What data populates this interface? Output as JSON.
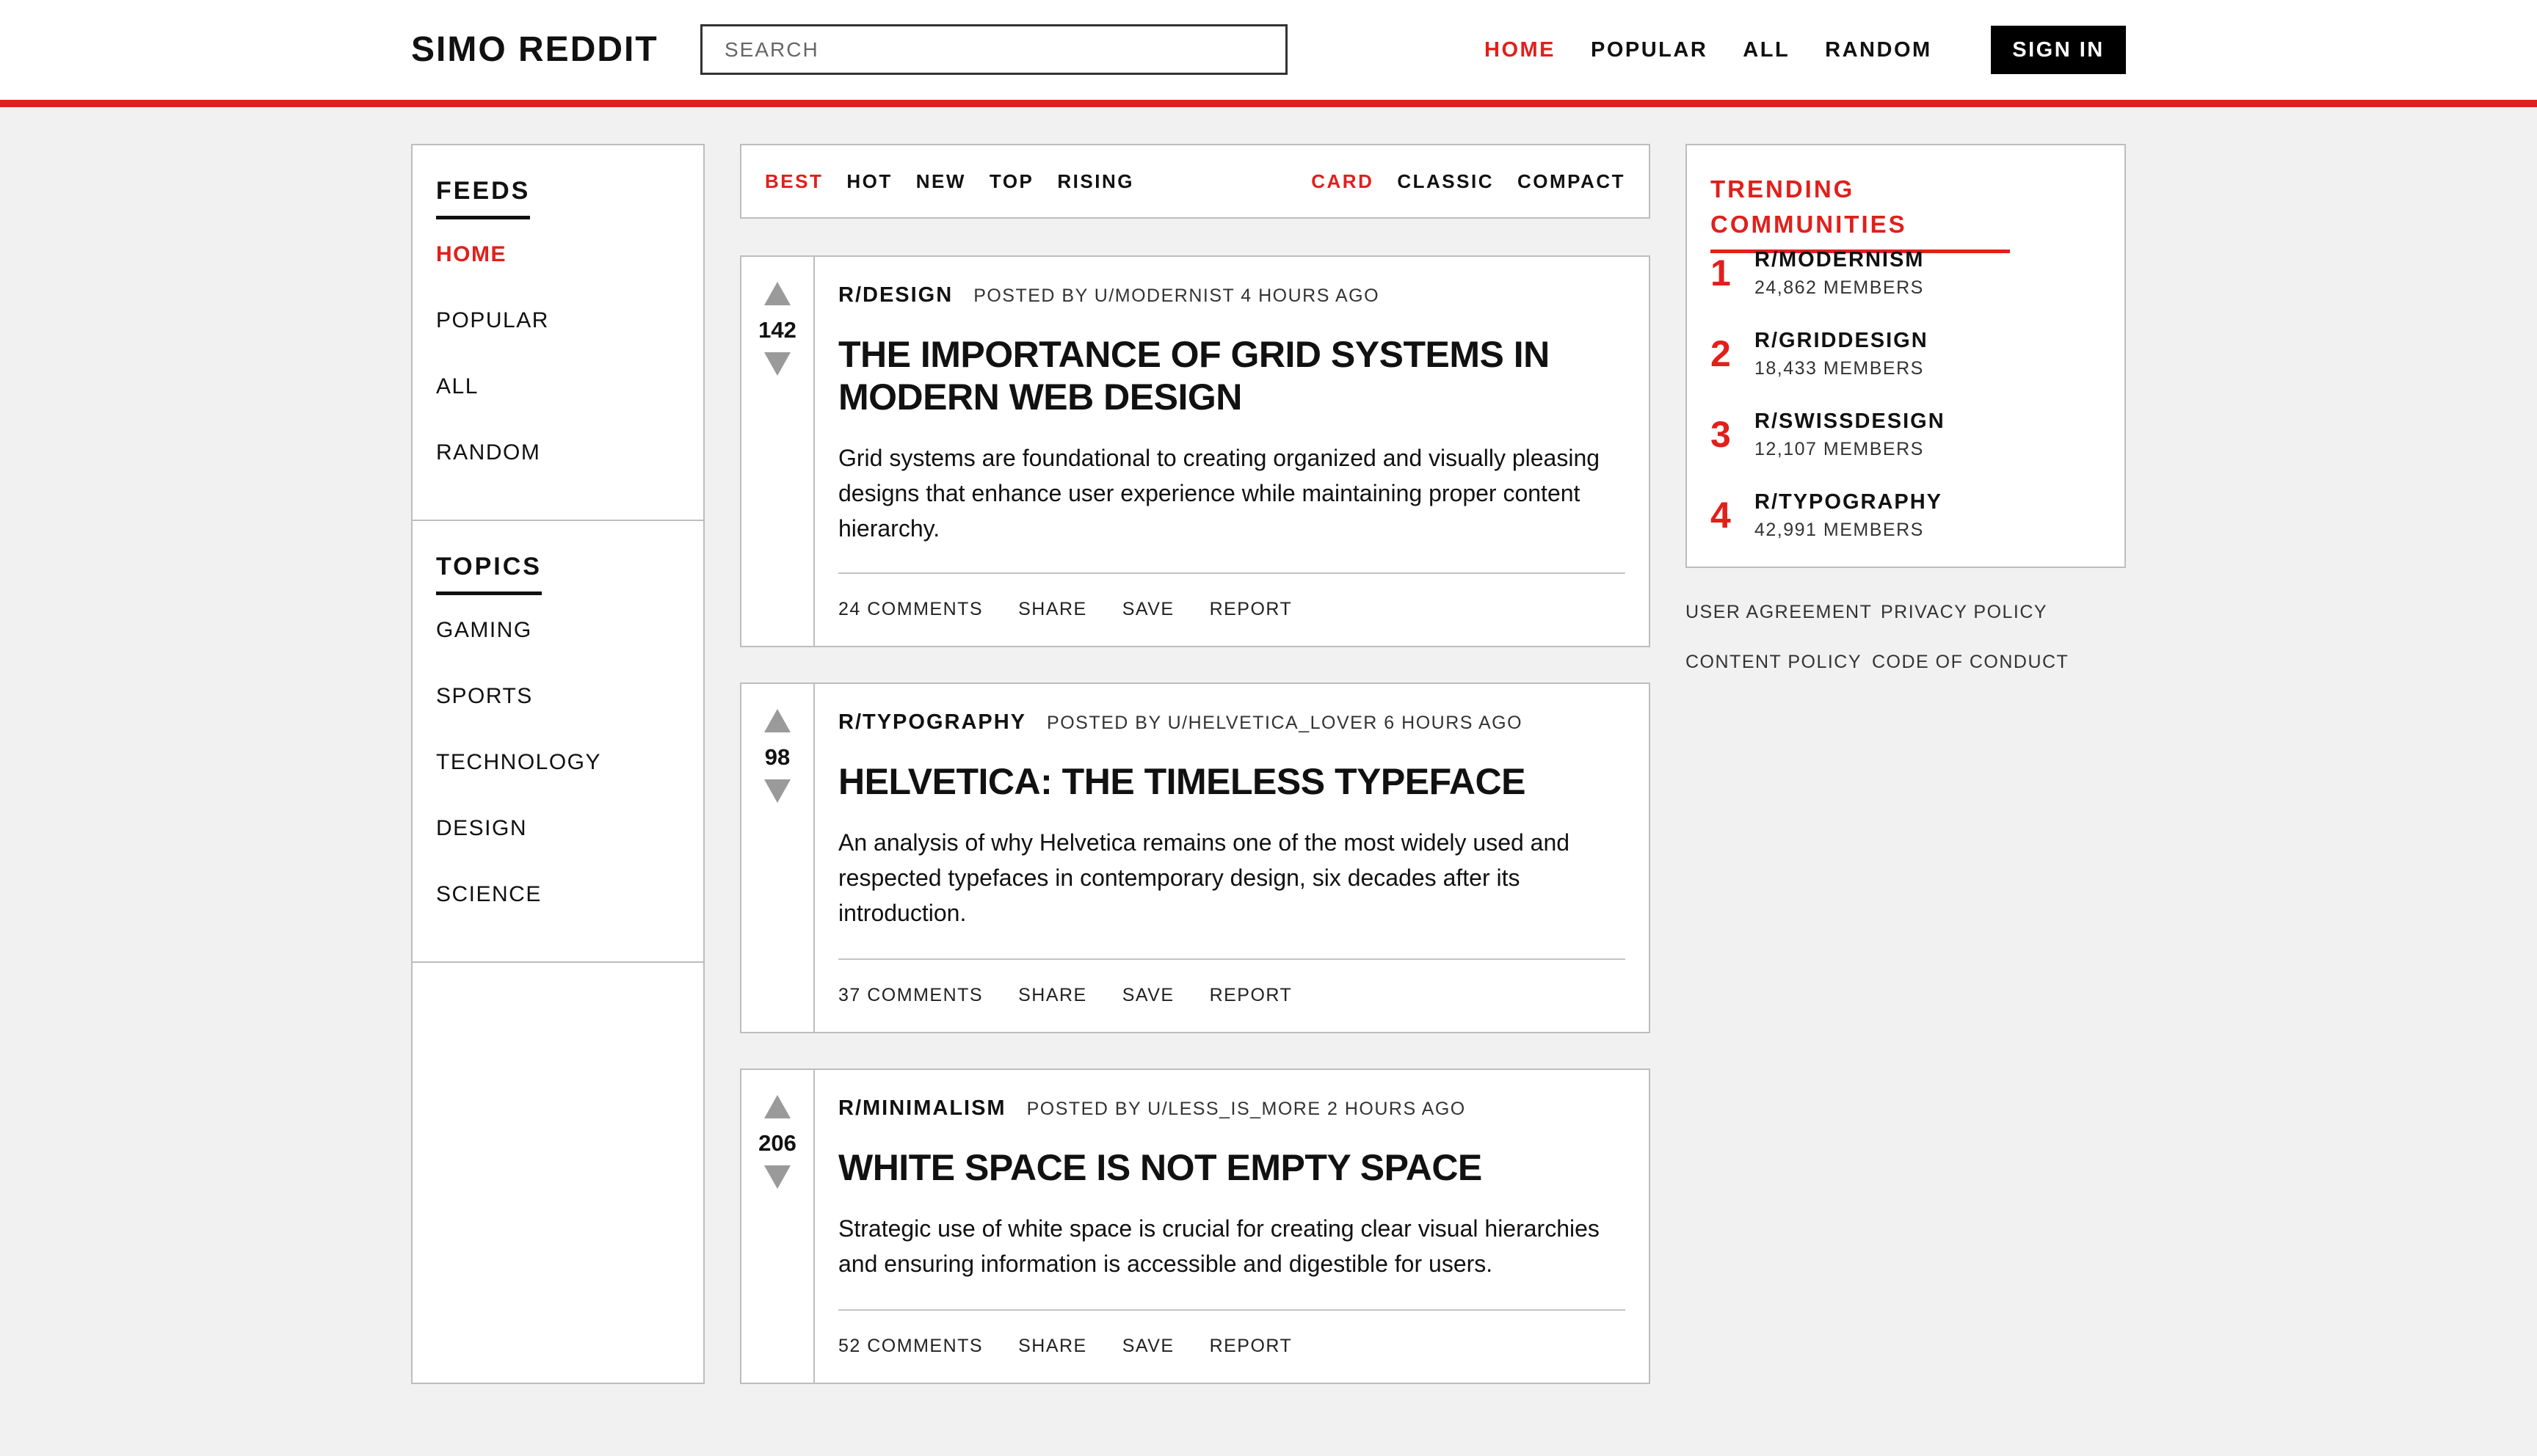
{
  "header": {
    "logo": "SIMO REDDIT",
    "search_placeholder": "SEARCH",
    "nav": [
      "HOME",
      "POPULAR",
      "ALL",
      "RANDOM"
    ],
    "active_nav": "HOME",
    "sign_in": "SIGN IN"
  },
  "sidebar": {
    "feeds": {
      "heading": "FEEDS",
      "items": [
        "HOME",
        "POPULAR",
        "ALL",
        "RANDOM"
      ],
      "active": "HOME"
    },
    "topics": {
      "heading": "TOPICS",
      "items": [
        "GAMING",
        "SPORTS",
        "TECHNOLOGY",
        "DESIGN",
        "SCIENCE"
      ]
    }
  },
  "sort": {
    "options": [
      "BEST",
      "HOT",
      "NEW",
      "TOP",
      "RISING"
    ],
    "active_sort": "BEST",
    "views": [
      "CARD",
      "CLASSIC",
      "COMPACT"
    ],
    "active_view": "CARD"
  },
  "posts": [
    {
      "score": "142",
      "community": "R/DESIGN",
      "posted": "POSTED BY U/MODERNIST 4 HOURS AGO",
      "title": "THE IMPORTANCE OF GRID SYSTEMS IN MODERN WEB DESIGN",
      "excerpt": "Grid systems are foundational to creating organized and visually pleasing designs that enhance user experience while maintaining proper content hierarchy.",
      "comments": "24 COMMENTS",
      "share": "SHARE",
      "save": "SAVE",
      "report": "REPORT"
    },
    {
      "score": "98",
      "community": "R/TYPOGRAPHY",
      "posted": "POSTED BY U/HELVETICA_LOVER 6 HOURS AGO",
      "title": "HELVETICA: THE TIMELESS TYPEFACE",
      "excerpt": "An analysis of why Helvetica remains one of the most widely used and respected typefaces in contemporary design, six decades after its introduction.",
      "comments": "37 COMMENTS",
      "share": "SHARE",
      "save": "SAVE",
      "report": "REPORT"
    },
    {
      "score": "206",
      "community": "R/MINIMALISM",
      "posted": "POSTED BY U/LESS_IS_MORE 2 HOURS AGO",
      "title": "WHITE SPACE IS NOT EMPTY SPACE",
      "excerpt": "Strategic use of white space is crucial for creating clear visual hierarchies and ensuring information is accessible and digestible for users.",
      "comments": "52 COMMENTS",
      "share": "SHARE",
      "save": "SAVE",
      "report": "REPORT"
    }
  ],
  "trending": {
    "heading": "TRENDING COMMUNITIES",
    "items": [
      {
        "rank": "1",
        "name": "R/MODERNISM",
        "members": "24,862 MEMBERS"
      },
      {
        "rank": "2",
        "name": "R/GRIDDESIGN",
        "members": "18,433 MEMBERS"
      },
      {
        "rank": "3",
        "name": "R/SWISSDESIGN",
        "members": "12,107 MEMBERS"
      },
      {
        "rank": "4",
        "name": "R/TYPOGRAPHY",
        "members": "42,991 MEMBERS"
      }
    ]
  },
  "footer_links": [
    "USER AGREEMENT",
    "PRIVACY POLICY",
    "CONTENT POLICY",
    "CODE OF CONDUCT"
  ],
  "colors": {
    "accent": "#e0201b",
    "text": "#111111",
    "background": "#f1f1f1"
  }
}
